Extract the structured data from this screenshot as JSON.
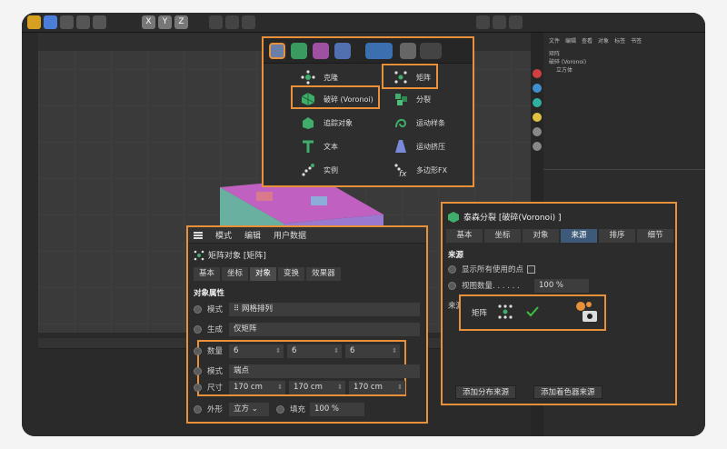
{
  "palette": {
    "items": [
      {
        "label": "克隆",
        "icon": "cloner-icon"
      },
      {
        "label": "矩阵",
        "icon": "matrix-icon"
      },
      {
        "label": "破碎 (Voronoi)",
        "icon": "voronoi-fracture-icon"
      },
      {
        "label": "分裂",
        "icon": "fracture-icon"
      },
      {
        "label": "追踪对象",
        "icon": "tracer-icon"
      },
      {
        "label": "运动样条",
        "icon": "motion-spline-icon"
      },
      {
        "label": "文本",
        "icon": "text-icon"
      },
      {
        "label": "运动挤压",
        "icon": "motion-extrude-icon"
      },
      {
        "label": "实例",
        "icon": "instance-icon"
      },
      {
        "label": "多边形FX",
        "icon": "polyfx-icon"
      }
    ]
  },
  "attr_panel": {
    "menu": [
      "模式",
      "编辑",
      "用户数据"
    ],
    "object_title": "矩阵对象 [矩阵]",
    "tabs": [
      "基本",
      "坐标",
      "对象",
      "变换",
      "效果器"
    ],
    "active_tab": "对象",
    "section": "对象属性",
    "rows": {
      "mode_label": "模式",
      "mode_value": "网格排列",
      "gen_label": "生成",
      "gen_value": "仅矩阵",
      "count_label": "数量",
      "count": [
        "6",
        "6",
        "6"
      ],
      "mode2_label": "模式",
      "mode2_value": "端点",
      "size_label": "尺寸",
      "size": [
        "170 cm",
        "170 cm",
        "170 cm"
      ],
      "shape_label": "外形",
      "shape_value": "立方",
      "fill_label": "填充",
      "fill_value": "100 %"
    }
  },
  "voronoi_panel": {
    "title": "泰森分裂 [破碎(Voronoi) ]",
    "tabs": [
      "基本",
      "坐标",
      "对象",
      "来源",
      "排序",
      "细节"
    ],
    "active_tab": "来源",
    "section": "来源",
    "show_all_points_label": "显示所有使用的点",
    "view_count_label": "视图数量. . . . . .",
    "view_count_value": "100 %",
    "source_label": "来源",
    "source_item": "矩阵",
    "add_dist_button": "添加分布来源",
    "add_shader_button": "添加着色器来源"
  },
  "objects_panel": {
    "menu": [
      "文件",
      "编辑",
      "查看",
      "对象",
      "标签",
      "书签"
    ],
    "items": [
      "矩阵",
      "破碎 (Voronoi)",
      "立方体"
    ]
  },
  "colors": {
    "accent": "#e8913a",
    "panel": "#2c2c2c",
    "check": "#3fbf3f"
  }
}
